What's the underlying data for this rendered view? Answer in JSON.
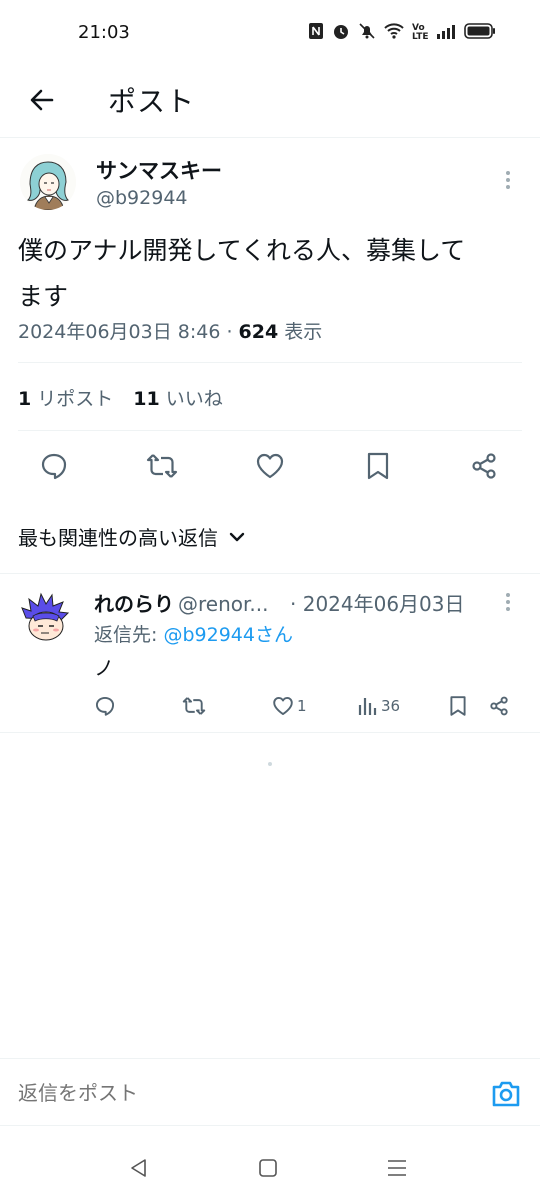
{
  "status_bar": {
    "time": "21:03",
    "icons": [
      "nfc-icon",
      "alarm-icon",
      "mute-icon",
      "wifi-icon",
      "volte-icon",
      "signal-icon",
      "battery-icon"
    ],
    "volte_label": "Vo LTE"
  },
  "header": {
    "title": "ポスト",
    "back_icon": "arrow-left-icon"
  },
  "post": {
    "author_name": "サンマスキー",
    "author_handle": "@b92944",
    "text_line1": "僕のアナル開発してくれる人、募集して",
    "text_line2": "ます",
    "timestamp": "2024年06月03日 8:46",
    "separator": " · ",
    "views": "624",
    "views_label": " 表示",
    "reposts_count": "1",
    "reposts_label": "リポスト",
    "likes_count": "11",
    "likes_label": "いいね"
  },
  "actions": [
    "reply-icon",
    "repost-icon",
    "like-icon",
    "bookmark-icon",
    "share-icon"
  ],
  "sort": {
    "label": "最も関連性の高い返信"
  },
  "reply": {
    "name": "れのらり",
    "handle": "@renor...",
    "date": "· 2024年06月03日",
    "reply_to_label": "返信先: ",
    "reply_to_handle": "@b92944さん",
    "text": "ノ",
    "likes": "1",
    "views": "36"
  },
  "compose": {
    "placeholder": "返信をポスト"
  },
  "colors": {
    "text": "#0f1419",
    "secondary": "#536471",
    "accent": "#1d9bf0",
    "divider": "#eff3f4"
  }
}
